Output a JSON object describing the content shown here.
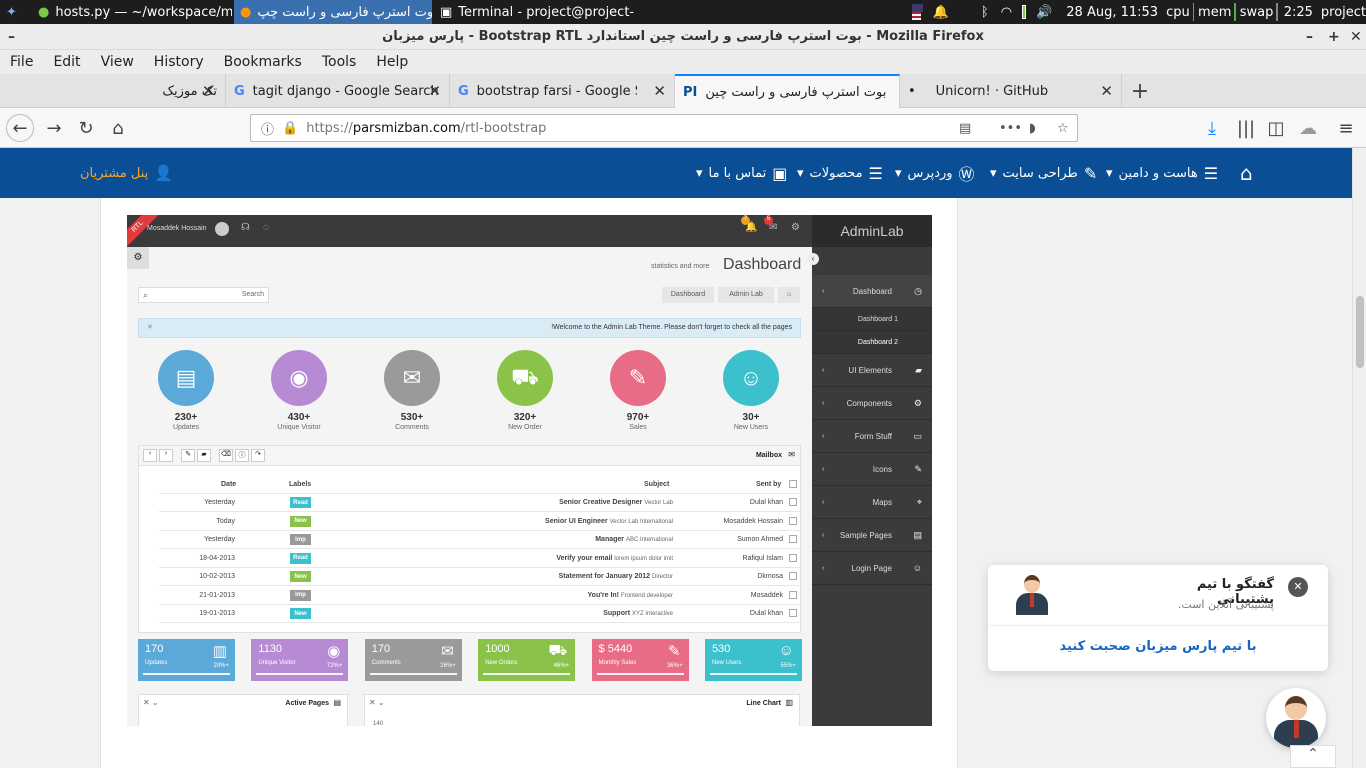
{
  "taskbar": {
    "items": [
      {
        "label": "hosts.py — ~/workspace/my..."
      },
      {
        "label": "بوت استرپ فارسی و راست چپ..."
      },
      {
        "label": "Terminal - project@project-I..."
      }
    ],
    "datetime": "28 Aug, 11:53",
    "cpu": "cpu",
    "mem": "mem",
    "swap": "swap",
    "uptime": "2:25",
    "user": "project"
  },
  "window": {
    "title": "پارس میزبان - Bootstrap RTL بوت استرپ فارسی و راست چین استاندارد - Mozilla Firefox"
  },
  "menu": [
    "File",
    "Edit",
    "View",
    "History",
    "Bookmarks",
    "Tools",
    "Help"
  ],
  "tabs": [
    {
      "label": "تک موزیک"
    },
    {
      "label": "tagit django - Google Search"
    },
    {
      "label": "bootstrap farsi - Google Search"
    },
    {
      "label": "بوت استرپ فارسی و راست چین"
    },
    {
      "label": "Unicorn! · GitHub"
    }
  ],
  "url": {
    "prefix": "https://",
    "host": "parsmizban.com",
    "path": "/rtl-bootstrap"
  },
  "site_nav": {
    "items": [
      "هاست و دامین",
      "طراحی سایت",
      "وردپرس",
      "محصولات",
      "تماس با ما"
    ],
    "panel": "پنل مشتریان"
  },
  "admin": {
    "brand": "AdminLab",
    "ribbon": "RTL",
    "user": "Mosaddek Hossain",
    "badges": [
      "7",
      "5"
    ],
    "page_title": "Dashboard",
    "page_subtitle": "statistics and more",
    "search_placeholder": "Search",
    "breadcrumb": [
      "Dashboard",
      "Admin Lab"
    ],
    "alert_text": "!Welcome to the Admin Lab Theme. Please don't forget to check all the pages",
    "stats": [
      {
        "value": "230+",
        "label": "Updates",
        "color": "#5aa9d8",
        "icon": "▤"
      },
      {
        "value": "430+",
        "label": "Unique Visitor",
        "color": "#b78bd3",
        "icon": "◉"
      },
      {
        "value": "530+",
        "label": "Comments",
        "color": "#9a9a9a",
        "icon": "✉"
      },
      {
        "value": "320+",
        "label": "New Order",
        "color": "#8bc34a",
        "icon": "⛟"
      },
      {
        "value": "970+",
        "label": "Sales",
        "color": "#e86c85",
        "icon": "✎"
      },
      {
        "value": "30+",
        "label": "New Users",
        "color": "#3cc0cc",
        "icon": "☺"
      }
    ],
    "mailbox": {
      "title": "Mailbox",
      "headers": [
        "Date",
        "Labels",
        "Subject",
        "Sent by"
      ],
      "rows": [
        {
          "date": "Yesterday",
          "label": "Read",
          "label_color": "#3cc0cc",
          "subject": "Senior Creative Designer",
          "sub": "Vector Lab",
          "sender": "Dulal khan"
        },
        {
          "date": "Today",
          "label": "New",
          "label_color": "#8bc34a",
          "subject": "Senior UI Engineer",
          "sub": "Vector Lab International",
          "sender": "Mosaddek Hossain"
        },
        {
          "date": "Yesterday",
          "label": "Imp",
          "label_color": "#999999",
          "subject": "Manager",
          "sub": "ABC International",
          "sender": "Sumon Ahmed"
        },
        {
          "date": "18-04-2013",
          "label": "Read",
          "label_color": "#3cc0cc",
          "subject": "Verify your email",
          "sub": "lorem ipsum dolor imit",
          "sender": "Rafiqul Islam"
        },
        {
          "date": "10-02-2013",
          "label": "New",
          "label_color": "#8bc34a",
          "subject": "Statement for January 2012",
          "sub": "Director",
          "sender": "Dkmosa"
        },
        {
          "date": "21-01-2013",
          "label": "Imp",
          "label_color": "#999999",
          "subject": "You're In!",
          "sub": "Frontend developer",
          "sender": "Mosaddek"
        },
        {
          "date": "19-01-2013",
          "label": "New",
          "label_color": "#3cc0cc",
          "subject": "Support",
          "sub": "XYZ Interactive",
          "sender": "Dulal khan"
        }
      ]
    },
    "tiles": [
      {
        "value": "170",
        "label": "Updates",
        "pct": "20%+",
        "color": "#5aa9d8"
      },
      {
        "value": "1130",
        "label": "Unique Visitor",
        "pct": "72%+",
        "color": "#b78bd3"
      },
      {
        "value": "170",
        "label": "Comments",
        "pct": "26%+",
        "color": "#9a9a9a"
      },
      {
        "value": "1000",
        "label": "New Orders",
        "pct": "46%+",
        "color": "#8bc34a"
      },
      {
        "value": "$ 5440",
        "label": "Monthly Sales",
        "pct": "36%+",
        "color": "#e86c85"
      },
      {
        "value": "530",
        "label": "New Users",
        "pct": "55%+",
        "color": "#3cc0cc"
      }
    ],
    "sidebar": [
      {
        "label": "Dashboard"
      },
      {
        "label": "Dashboard 1"
      },
      {
        "label": "Dashboard 2"
      },
      {
        "label": "UI Elements"
      },
      {
        "label": "Components"
      },
      {
        "label": "Form Stuff"
      },
      {
        "label": "Icons"
      },
      {
        "label": "Maps"
      },
      {
        "label": "Sample Pages"
      },
      {
        "label": "Login Page"
      }
    ],
    "panels": [
      "Active Pages",
      "Line Chart"
    ],
    "chart_tick": "140"
  },
  "chat": {
    "title": "گفتگو با تیم پشتیبانی",
    "subtitle": "پشتیبانی آنلاین است.",
    "cta": "با تیم پارس میزبان صحبت کنید"
  }
}
